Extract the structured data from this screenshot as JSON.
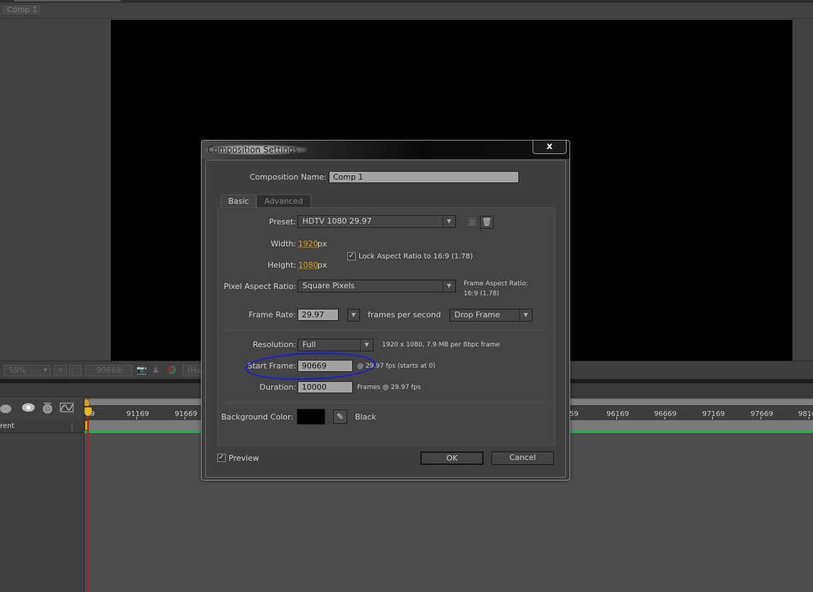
{
  "panel": {
    "comp_tab": "Comp 1"
  },
  "viewer_toolbar": {
    "zoom": "50%",
    "timecode": "90669",
    "resolution_partial": "(Ha"
  },
  "timeline": {
    "ruler_ticks_left": [
      "9",
      "91169",
      "91669"
    ],
    "ruler_ticks_right": [
      "59",
      "96169",
      "96669",
      "97169",
      "97669",
      "9816"
    ],
    "layer_column_partial": "rent",
    "icons": [
      "motion-blur-icon",
      "draft-3d-icon",
      "brainstorm-icon",
      "graph-editor-icon"
    ]
  },
  "dialog": {
    "title": "Composition Settings",
    "close_label": "x",
    "comp_name_label": "Composition Name:",
    "comp_name_value": "Comp 1",
    "tabs": [
      {
        "label": "Basic",
        "active": true
      },
      {
        "label": "Advanced",
        "active": false
      }
    ],
    "preset_label": "Preset:",
    "preset_value": "HDTV 1080 29.97",
    "width_label": "Width:",
    "width_value": "1920",
    "height_label": "Height:",
    "height_value": "1080",
    "px_unit": "px",
    "lock_aspect_label": "Lock Aspect Ratio to 16:9 (1.78)",
    "lock_aspect_checked": true,
    "par_label": "Pixel Aspect Ratio:",
    "par_value": "Square Pixels",
    "frame_aspect_label": "Frame Aspect Ratio:",
    "frame_aspect_value": "16:9 (1.78)",
    "frame_rate_label": "Frame Rate:",
    "frame_rate_value": "29.97",
    "fps_text": "frames per second",
    "drop_frame_value": "Drop Frame",
    "resolution_label": "Resolution:",
    "resolution_value": "Full",
    "resolution_info": "1920 x 1080, 7.9 MB per 8bpc frame",
    "start_frame_label": "Start Frame:",
    "start_frame_value": "90669",
    "start_frame_info": "@ 29.97 fps (starts at 0)",
    "duration_label": "Duration:",
    "duration_value": "10000",
    "duration_info": "Frames @ 29.97 fps",
    "bg_color_label": "Background Color:",
    "bg_color_hex": "#000000",
    "bg_color_name": "Black",
    "preview_label": "Preview",
    "preview_checked": true,
    "ok_label": "OK",
    "cancel_label": "Cancel"
  },
  "colors": {
    "accent_orange": "#d3a020",
    "annotation_blue": "#1a1ae0",
    "playhead_red": "#b01e1e",
    "layer_green": "#22b14c"
  }
}
